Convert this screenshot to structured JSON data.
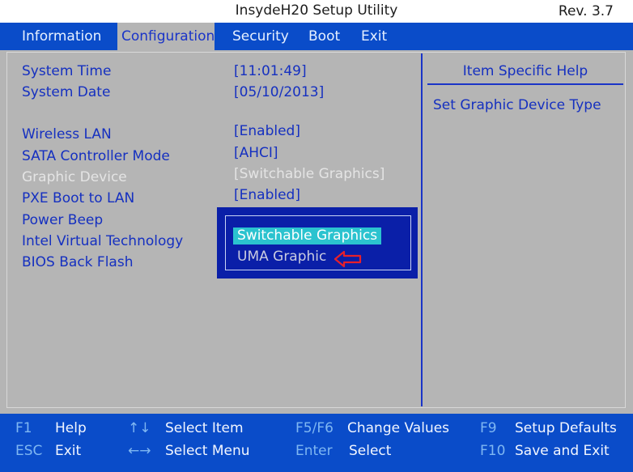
{
  "header": {
    "title": "InsydeH20 Setup Utility",
    "revision": "Rev. 3.7"
  },
  "menu": {
    "items": [
      {
        "label": "Information"
      },
      {
        "label": "Configuration",
        "active": true
      },
      {
        "label": "Security"
      },
      {
        "label": "Boot"
      },
      {
        "label": "Exit"
      }
    ]
  },
  "settings": [
    {
      "label": "System Time",
      "value": "[11:01:49]"
    },
    {
      "label": "System Date",
      "value": "[05/10/2013]"
    },
    {
      "label": "Wireless LAN",
      "value": "[Enabled]"
    },
    {
      "label": "SATA Controller Mode",
      "value": "[AHCI]"
    },
    {
      "label": "Graphic Device",
      "value": "[Switchable Graphics]",
      "selected": true
    },
    {
      "label": "PXE Boot to LAN",
      "value": "[Enabled]"
    },
    {
      "label": "Power Beep"
    },
    {
      "label": "Intel Virtual Technology"
    },
    {
      "label": "BIOS Back Flash"
    }
  ],
  "help": {
    "title": "Item Specific Help",
    "text": "Set Graphic Device Type"
  },
  "popup": {
    "options": [
      {
        "label": "Switchable Graphics",
        "highlighted": true
      },
      {
        "label": "UMA Graphic"
      }
    ],
    "annotation_arrow_color": "#e8202a"
  },
  "footer": {
    "keys": [
      {
        "key": "F1",
        "desc": "Help"
      },
      {
        "key": "ESC",
        "desc": "Exit"
      },
      {
        "key": "↑↓",
        "desc": "Select Item"
      },
      {
        "key": "←→",
        "desc": "Select Menu"
      },
      {
        "key": "F5/F6",
        "desc": "Change Values"
      },
      {
        "key": "Enter",
        "desc": "Select"
      },
      {
        "key": "F9",
        "desc": "Setup Defaults"
      },
      {
        "key": "F10",
        "desc": "Save and Exit"
      }
    ]
  },
  "colors": {
    "menu_bar": "#0a4cc9",
    "panel": "#b5b5b5",
    "text_blue": "#1530c0",
    "popup_bg": "#0a1fa8",
    "highlight": "#2bc3cf"
  }
}
